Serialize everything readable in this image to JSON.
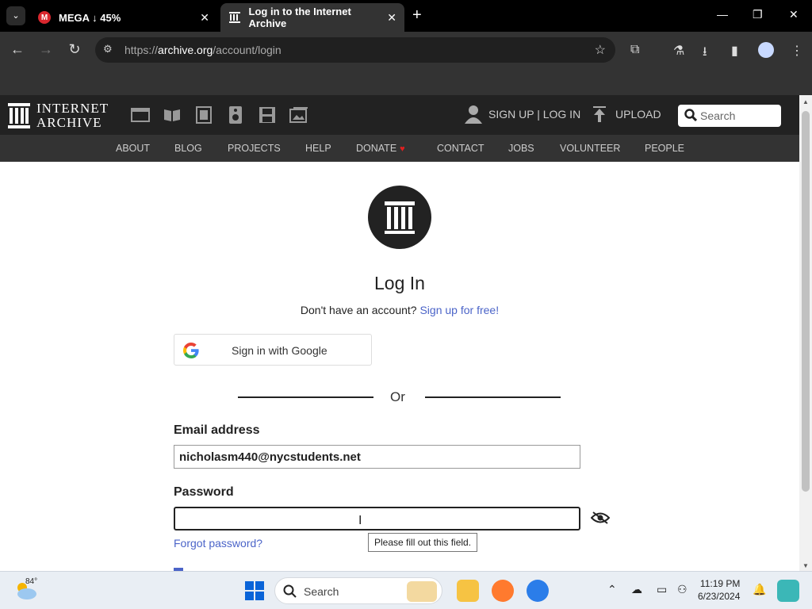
{
  "browser": {
    "tabs": [
      {
        "title": "MEGA ↓ 45%",
        "favicon": "mega-icon",
        "active": false
      },
      {
        "title": "Log in to the Internet Archive",
        "favicon": "archive-icon",
        "active": true
      }
    ],
    "url_prefix": "https://",
    "url_host": "archive.org",
    "url_path": "/account/login"
  },
  "ia_header": {
    "logo_line1": "INTERNET",
    "logo_line2": "ARCHIVE",
    "media_icons": [
      "web-icon",
      "texts-icon",
      "video-icon",
      "audio-icon",
      "software-icon",
      "images-icon"
    ],
    "user_link": "SIGN UP | LOG IN",
    "upload_label": "UPLOAD",
    "search_placeholder": "Search",
    "nav": [
      "ABOUT",
      "BLOG",
      "PROJECTS",
      "HELP",
      "DONATE",
      "CONTACT",
      "JOBS",
      "VOLUNTEER",
      "PEOPLE"
    ]
  },
  "login": {
    "title": "Log In",
    "no_account_text": "Don't have an account?",
    "signup_link": "Sign up for free!",
    "google_button": "Sign in with Google",
    "or_text": "Or",
    "email_label": "Email address",
    "email_value": "nicholasm440@nycstudents.net",
    "password_label": "Password",
    "password_value": "",
    "forgot_link": "Forgot password?",
    "validation_tooltip": "Please fill out this field."
  },
  "taskbar": {
    "weather_temp": "84°",
    "search_placeholder": "Search",
    "time": "11:19 PM",
    "date": "6/23/2024"
  },
  "colors": {
    "ia_dark": "#222222",
    "ia_nav": "#333333",
    "link": "#4b64c8"
  }
}
